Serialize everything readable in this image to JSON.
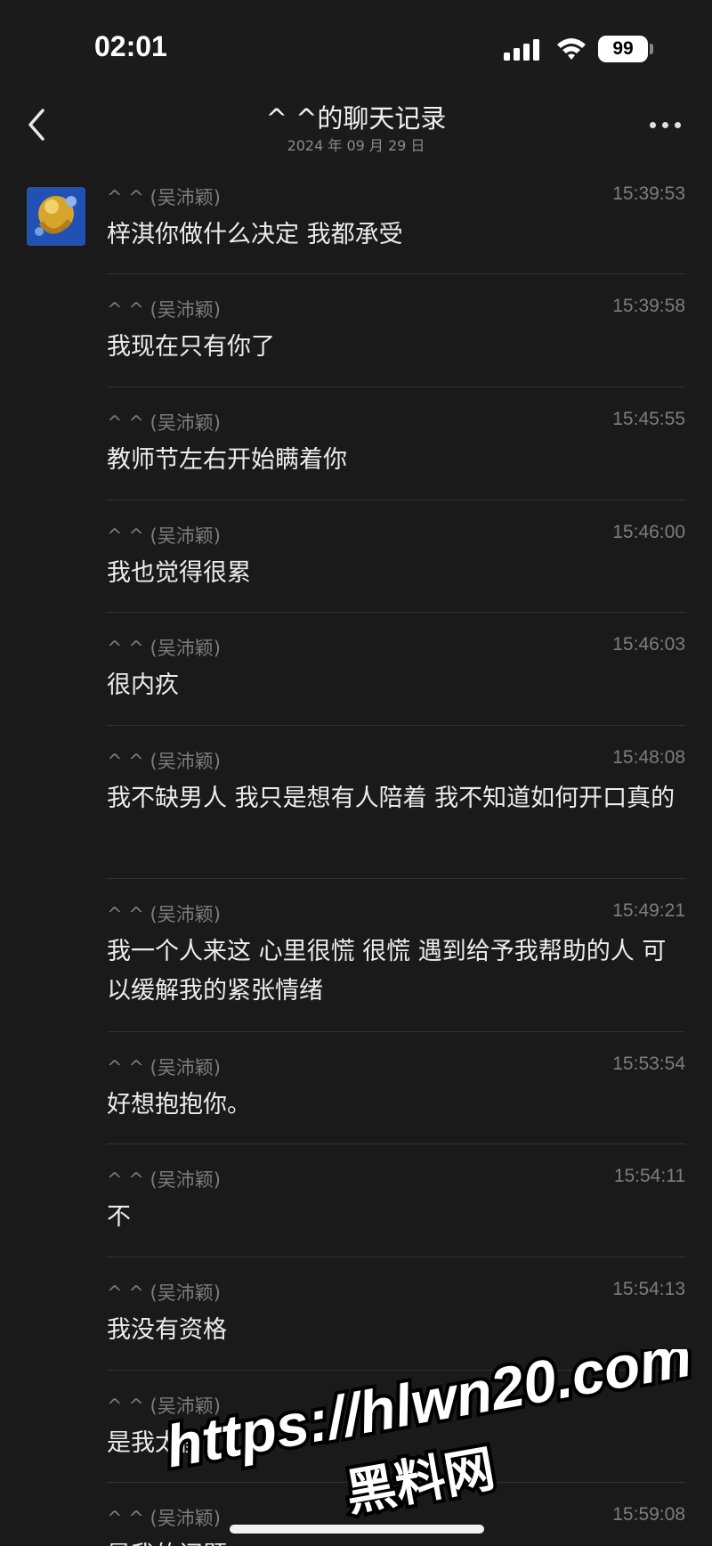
{
  "status_bar": {
    "time": "02:01",
    "battery": "99"
  },
  "header": {
    "title": "^ ^的聊天记录",
    "date": "2024 年 09 月 29 日"
  },
  "messages": [
    {
      "sender": "^ ^ (吴沛颖)",
      "time": "15:39:53",
      "text": "梓淇你做什么决定 我都承受"
    },
    {
      "sender": "^ ^ (吴沛颖)",
      "time": "15:39:58",
      "text": "我现在只有你了"
    },
    {
      "sender": "^ ^ (吴沛颖)",
      "time": "15:45:55",
      "text": "教师节左右开始瞒着你"
    },
    {
      "sender": "^ ^ (吴沛颖)",
      "time": "15:46:00",
      "text": "我也觉得很累"
    },
    {
      "sender": "^ ^ (吴沛颖)",
      "time": "15:46:03",
      "text": "很内疚"
    },
    {
      "sender": "^ ^ (吴沛颖)",
      "time": "15:48:08",
      "text": "我不缺男人 我只是想有人陪着 我不知道如何开口真的"
    },
    {
      "sender": "^ ^ (吴沛颖)",
      "time": "15:49:21",
      "text": "我一个人来这 心里很慌 很慌 遇到给予我帮助的人 可以缓解我的紧张情绪"
    },
    {
      "sender": "^ ^ (吴沛颖)",
      "time": "15:53:54",
      "text": "好想抱抱你。"
    },
    {
      "sender": "^ ^ (吴沛颖)",
      "time": "15:54:11",
      "text": "不"
    },
    {
      "sender": "^ ^ (吴沛颖)",
      "time": "15:54:13",
      "text": "我没有资格"
    },
    {
      "sender": "^ ^ (吴沛颖)",
      "time": "",
      "text": "是我太傻"
    },
    {
      "sender": "^ ^ (吴沛颖)",
      "time": "15:59:08",
      "text": "是我的问题"
    }
  ],
  "watermark": {
    "url": "https://hlwn20.com",
    "name": "黑料网"
  },
  "icons": {
    "back": "chevron-left-icon",
    "more": "more-horizontal-icon",
    "signal": "cellular-signal-icon",
    "wifi": "wifi-icon",
    "battery": "battery-icon",
    "avatar": "avatar"
  },
  "colors": {
    "background": "#1a1a1a",
    "text": "#ececec",
    "meta": "#7d7d7d",
    "divider": "#333333"
  }
}
